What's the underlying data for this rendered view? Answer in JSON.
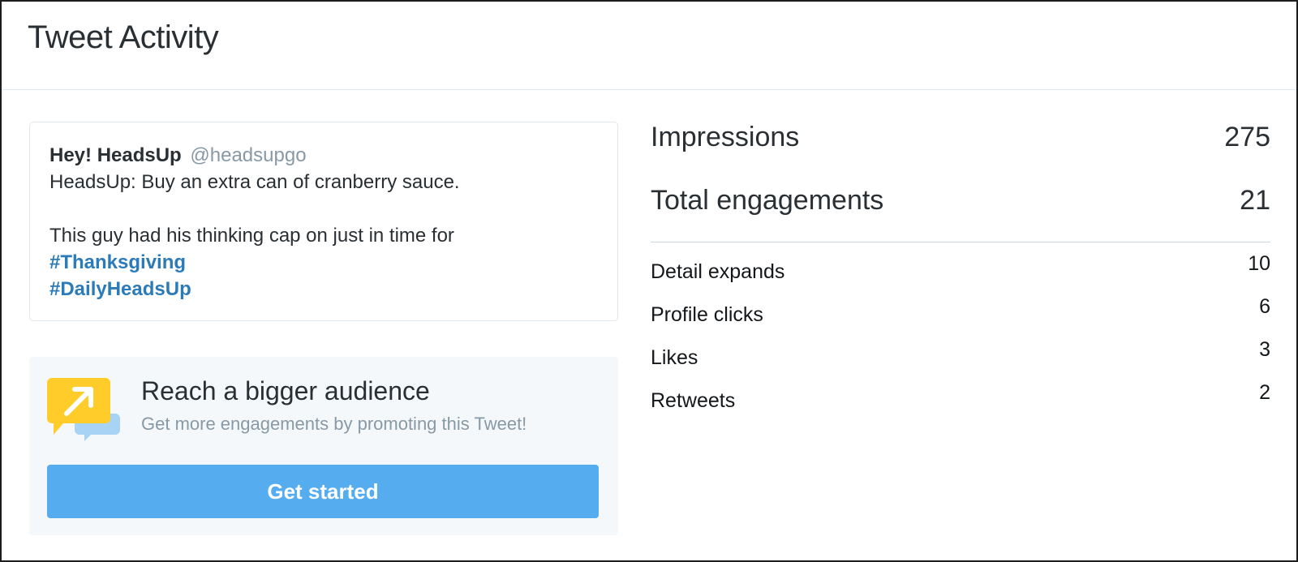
{
  "header": {
    "title": "Tweet Activity"
  },
  "tweet": {
    "name": "Hey! HeadsUp",
    "handle": "@headsupgo",
    "line1": "HeadsUp: Buy an extra can of cranberry sauce.",
    "line2": "This guy had his thinking cap on just in time for",
    "hashtags": [
      "#Thanksgiving",
      "#DailyHeadsUp"
    ]
  },
  "promo": {
    "title": "Reach a bigger audience",
    "subtitle": "Get more engagements by promoting this Tweet!",
    "button_label": "Get started",
    "icon": "promote-arrow-chat-icon",
    "colors": {
      "icon_yellow": "#ffcc29",
      "icon_blue": "#a8d3f5",
      "button": "#55acee"
    }
  },
  "stats": {
    "impressions": {
      "label": "Impressions",
      "value": "275"
    },
    "total_engagements": {
      "label": "Total engagements",
      "value": "21"
    },
    "breakdown": [
      {
        "label": "Detail expands",
        "value": "10"
      },
      {
        "label": "Profile clicks",
        "value": "6"
      },
      {
        "label": "Likes",
        "value": "3"
      },
      {
        "label": "Retweets",
        "value": "2"
      }
    ]
  }
}
